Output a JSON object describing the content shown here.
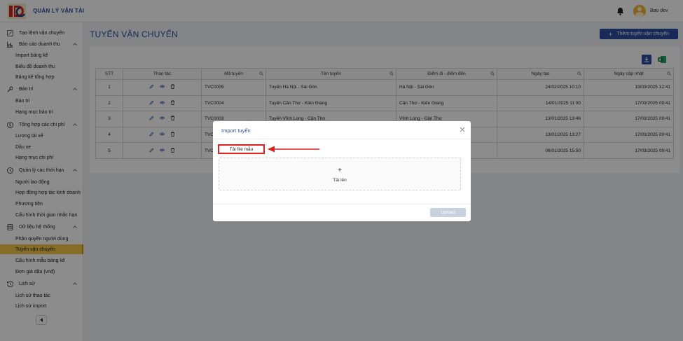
{
  "app": {
    "title": "QUẢN LÝ VẬN TẢI",
    "user_name": "Bao dev"
  },
  "sidebar": {
    "items": [
      {
        "type": "group",
        "label": "Tạo lệnh vận chuyển",
        "icon": "edit-square-icon",
        "chevron": false
      },
      {
        "type": "group",
        "label": "Báo cáo doanh thu",
        "icon": "bar-chart-icon",
        "chevron": true
      },
      {
        "type": "sub",
        "label": "Import bảng kê"
      },
      {
        "type": "sub",
        "label": "Biểu đồ doanh thu"
      },
      {
        "type": "sub",
        "label": "Bảng kê tổng hợp"
      },
      {
        "type": "group",
        "label": "Bảo trì",
        "icon": "wrench-icon",
        "chevron": true
      },
      {
        "type": "sub",
        "label": "Bảo trì"
      },
      {
        "type": "sub",
        "label": "Hạng mục bảo trì"
      },
      {
        "type": "group",
        "label": "Tổng hợp các chi phí",
        "icon": "dollar-circle-icon",
        "chevron": true
      },
      {
        "type": "sub",
        "label": "Lương tài xế"
      },
      {
        "type": "sub",
        "label": "Dầu xe"
      },
      {
        "type": "sub",
        "label": "Hạng mục chi phí"
      },
      {
        "type": "group",
        "label": "Quản lý các thời hạn",
        "icon": "clock-icon",
        "chevron": true
      },
      {
        "type": "sub",
        "label": "Người lao động"
      },
      {
        "type": "sub",
        "label": "Hợp đồng hợp tác kinh doanh"
      },
      {
        "type": "sub",
        "label": "Phương tiện"
      },
      {
        "type": "sub",
        "label": "Cấu hình thời gian nhắc hạn"
      },
      {
        "type": "group",
        "label": "Dữ liệu hệ thống",
        "icon": "database-icon",
        "chevron": true
      },
      {
        "type": "sub",
        "label": "Phân quyền người dùng"
      },
      {
        "type": "sub",
        "label": "Tuyến vận chuyển",
        "active": true
      },
      {
        "type": "sub",
        "label": "Cấu hình mẫu bảng kê"
      },
      {
        "type": "sub",
        "label": "Đơn giá dầu (vnđ)"
      },
      {
        "type": "group",
        "label": "Lịch sử",
        "icon": "history-icon",
        "chevron": true
      },
      {
        "type": "sub",
        "label": "Lịch sử thao tác"
      },
      {
        "type": "sub",
        "label": "Lịch sử import"
      }
    ]
  },
  "page": {
    "title": "TUYẾN VẬN CHUYỂN",
    "add_button": "Thêm tuyến vận chuyển"
  },
  "table": {
    "headers": [
      "STT",
      "Thao tác",
      "Mã tuyến",
      "Tên tuyến",
      "Điểm đi - điểm đến",
      "Ngày tạo",
      "Ngày cập nhật"
    ],
    "rows": [
      {
        "stt": "1",
        "code": "TVC0005",
        "name": "Tuyến Hà Nội - Sài Gòn",
        "route": "Hà Nội - Sài Gòn",
        "created": "24/02/2025 10:10",
        "updated": "19/03/2025 12:41"
      },
      {
        "stt": "2",
        "code": "TVC0004",
        "name": "Tuyến Cần Thơ - Kiên Giang",
        "route": "Cần Thơ - Kiên Giang",
        "created": "14/01/2025 11:00",
        "updated": "17/03/2025 09:41"
      },
      {
        "stt": "3",
        "code": "TVC0003",
        "name": "Tuyến Vĩnh Long - Cần Thơ",
        "route": "Vĩnh Long - Cần Thơ",
        "created": "13/01/2025 13:46",
        "updated": "17/03/2025 09:41"
      },
      {
        "stt": "4",
        "code": "TVC",
        "name": "",
        "route": "",
        "created": "13/01/2025 13:27",
        "updated": "17/03/2025 09:41"
      },
      {
        "stt": "5",
        "code": "TVC",
        "name": "",
        "route": "",
        "created": "06/01/2025 15:50",
        "updated": "17/03/2025 09:41"
      }
    ]
  },
  "modal": {
    "title": "Import tuyến",
    "download_template": "Tải file mẫu",
    "dropzone_plus": "+",
    "dropzone_label": "Tải lên",
    "upload_button": "Upload"
  },
  "colors": {
    "primary": "#2a4da0",
    "active_menu": "#f3c74a",
    "highlight": "#e0201c"
  }
}
